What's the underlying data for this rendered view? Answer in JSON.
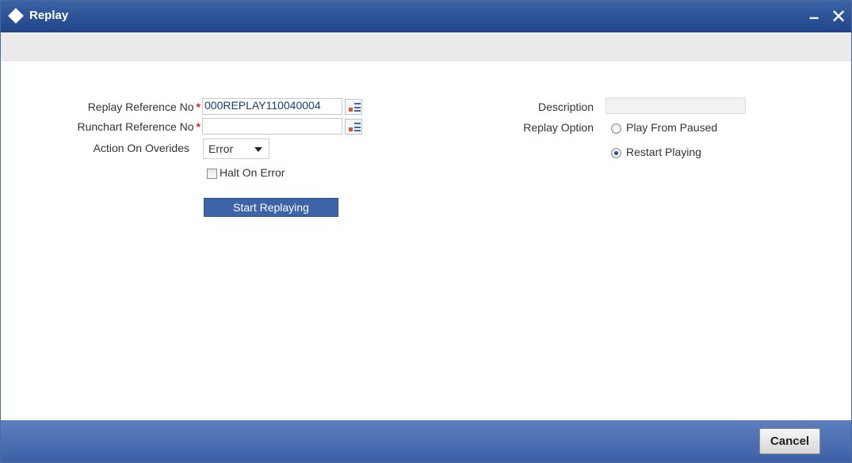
{
  "window": {
    "title": "Replay",
    "minimize_glyph": "–",
    "close_glyph": "✕"
  },
  "form": {
    "replay_ref_label": "Replay Reference No",
    "replay_ref_value": "000REPLAY110040004",
    "runchart_ref_label": "Runchart Reference No",
    "runchart_ref_value": "",
    "required_marker": "*",
    "action_label": "Action On Overides",
    "action_value": "Error",
    "halt_label": "Halt On Error",
    "halt_checked": false,
    "start_button": "Start Replaying",
    "description_label": "Description",
    "description_value": "",
    "replay_option_label": "Replay Option",
    "options": [
      {
        "label": "Play From Paused",
        "selected": false
      },
      {
        "label": "Restart Playing",
        "selected": true
      }
    ]
  },
  "footer": {
    "cancel_label": "Cancel"
  },
  "colors": {
    "titlebar": "#2a4f92",
    "footer": "#4c70b3",
    "required": "#d22222",
    "start_button": "#3e63a6"
  }
}
